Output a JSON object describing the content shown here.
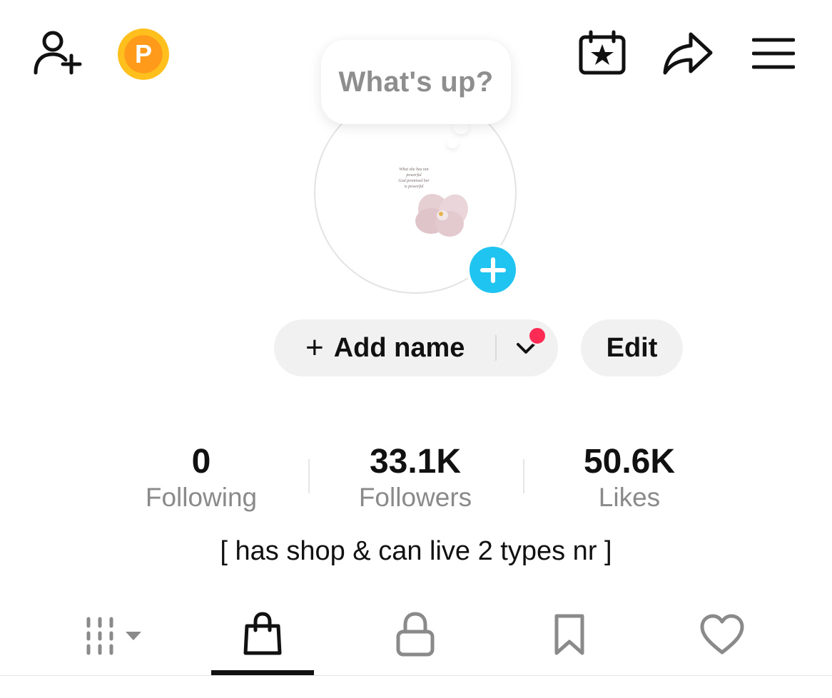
{
  "header": {
    "add_friend_icon": "person-plus-icon",
    "points_coin_letter": "P",
    "calendar_icon": "calendar-star-icon",
    "share_icon": "share-arrow-icon",
    "menu_icon": "hamburger-menu-icon"
  },
  "status_bubble": {
    "text": "What's up?"
  },
  "avatar": {
    "caption_lines": [
      "What she has not",
      "powerful",
      "God promised her",
      "is powerful"
    ]
  },
  "actions": {
    "add_name_plus": "+",
    "add_name_label": "Add name",
    "edit_label": "Edit"
  },
  "stats": [
    {
      "value": "0",
      "label": "Following"
    },
    {
      "value": "33.1K",
      "label": "Followers"
    },
    {
      "value": "50.6K",
      "label": "Likes"
    }
  ],
  "bio": "[ has shop & can live 2 types nr ]",
  "tabs": [
    {
      "icon": "videos-grid-icon",
      "active": false
    },
    {
      "icon": "shopping-bag-icon",
      "active": true
    },
    {
      "icon": "lock-icon",
      "active": false
    },
    {
      "icon": "bookmark-icon",
      "active": false
    },
    {
      "icon": "heart-icon",
      "active": false
    }
  ],
  "colors": {
    "accent_blue": "#20c4f0",
    "notification_red": "#fe2c55",
    "coin_orange": "#ff9a1a",
    "coin_yellow": "#ffc01e",
    "muted_gray": "#8a8a8a",
    "pill_gray": "#f1f1f2"
  }
}
